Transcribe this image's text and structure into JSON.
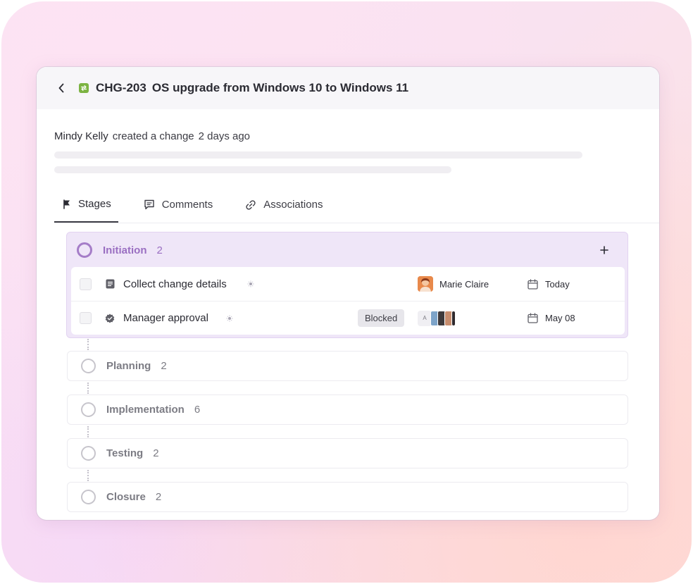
{
  "header": {
    "change_id": "CHG-203",
    "title": "OS upgrade from Windows 10 to Windows 11"
  },
  "activity": {
    "author": "Mindy Kelly",
    "verb": "created a change",
    "time": "2 days ago"
  },
  "tabs": [
    {
      "label": "Stages",
      "icon": "flag-icon",
      "active": true
    },
    {
      "label": "Comments",
      "icon": "comment-icon",
      "active": false
    },
    {
      "label": "Associations",
      "icon": "link-icon",
      "active": false
    }
  ],
  "stages": [
    {
      "name": "Initiation",
      "count": "2",
      "expanded": true,
      "tasks": [
        {
          "name": "Collect change details",
          "icon": "document-icon",
          "badge": "",
          "assignee": "Marie Claire",
          "due": "Today"
        },
        {
          "name": "Manager approval",
          "icon": "verified-icon",
          "badge": "Blocked",
          "assignee_initial": "A",
          "due": "May 08"
        }
      ]
    },
    {
      "name": "Planning",
      "count": "2"
    },
    {
      "name": "Implementation",
      "count": "6"
    },
    {
      "name": "Testing",
      "count": "2"
    },
    {
      "name": "Closure",
      "count": "2"
    }
  ],
  "colors": {
    "accent": "#9a6fc2",
    "stage_active_bg": "#efe6f8",
    "change_icon": "#7cb342",
    "avatar": "#e8894b"
  }
}
